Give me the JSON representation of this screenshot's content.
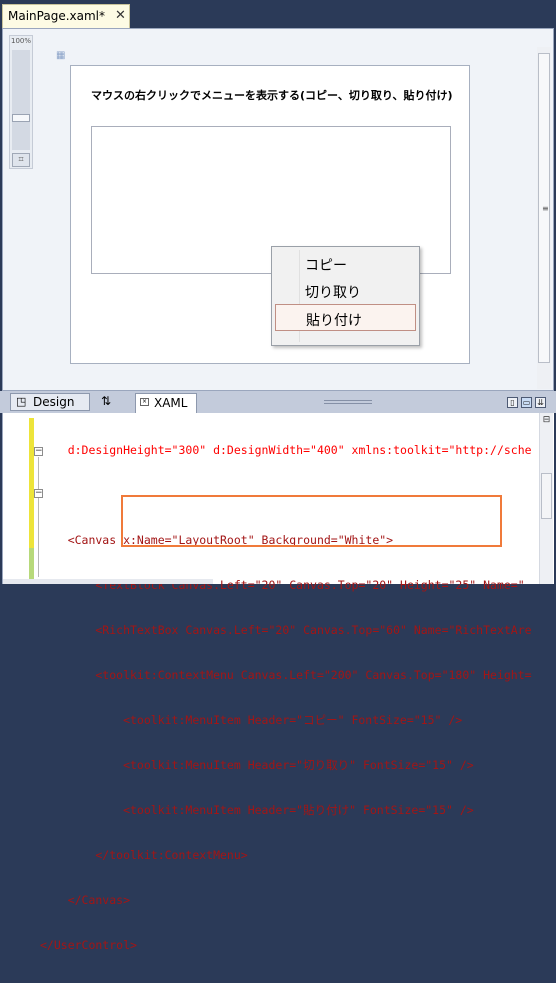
{
  "document_tab": {
    "title": "MainPage.xaml*",
    "close_glyph": "✕"
  },
  "designer": {
    "zoom_label": "100%",
    "heading": "マウスの右クリックでメニューを表示する(コピー、切り取り、貼り付け)",
    "context_menu": [
      "コピー",
      "切り取り",
      "貼り付け"
    ]
  },
  "panel_tabs": {
    "design": "Design",
    "swap": "⇅",
    "xaml": "XAML"
  },
  "code_lines": [
    "    d:DesignHeight=\"300\" d:DesignWidth=\"400\" xmlns:toolkit=\"http://sche",
    "",
    "    <Canvas x:Name=\"LayoutRoot\" Background=\"White\">",
    "        <TextBlock Canvas.Left=\"20\" Canvas.Top=\"20\" Height=\"25\" Name=\"",
    "        <RichTextBox Canvas.Left=\"20\" Canvas.Top=\"60\" Name=\"RichTextAre",
    "        <toolkit:ContextMenu Canvas.Left=\"200\" Canvas.Top=\"180\" Height=",
    "            <toolkit:MenuItem Header=\"コピー\" FontSize=\"15\" />",
    "            <toolkit:MenuItem Header=\"切り取り\" FontSize=\"15\" />",
    "            <toolkit:MenuItem Header=\"貼り付け\" FontSize=\"15\" />",
    "        </toolkit:ContextMenu>",
    "    </Canvas>",
    "</UserControl>"
  ],
  "colors": {
    "highlight_box": "#f07a3a",
    "frame": "#2b3a58",
    "tab_bg": "#fdfbe4"
  }
}
